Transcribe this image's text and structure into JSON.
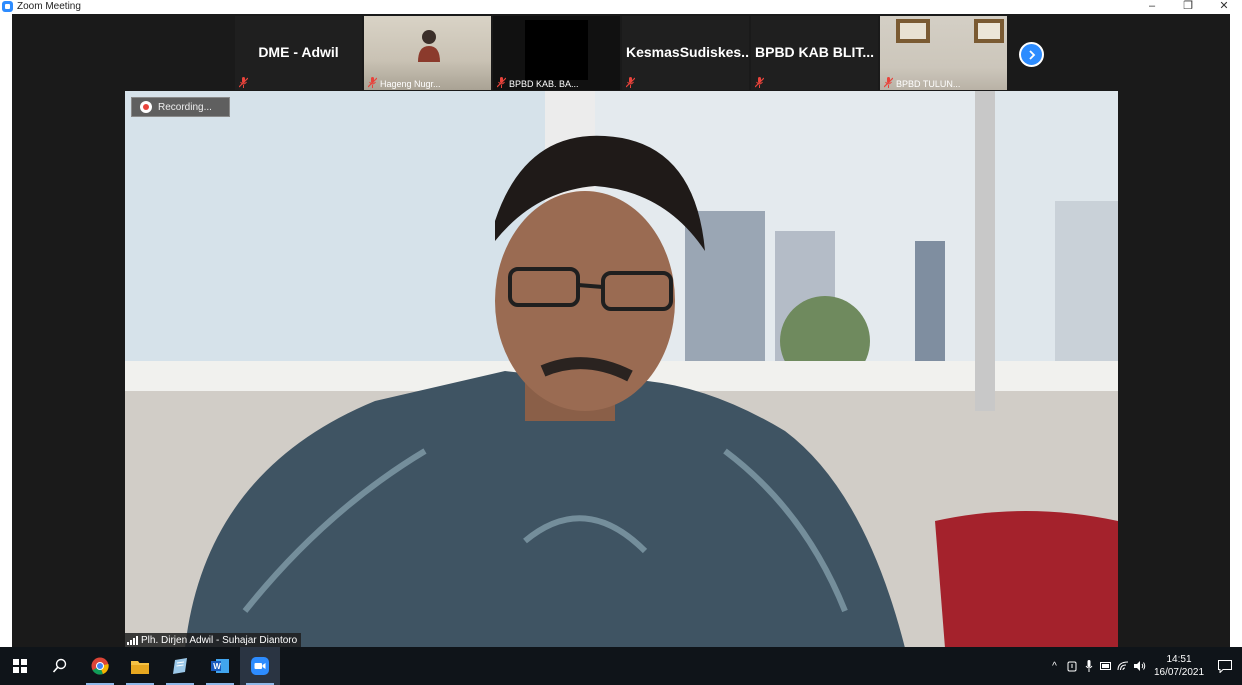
{
  "window": {
    "title": "Zoom Meeting",
    "minimize": "–",
    "restore": "❐",
    "close": "✕"
  },
  "thumbnails": [
    {
      "name": "DME - Adwil",
      "label": ""
    },
    {
      "name": "",
      "label": "Hageng Nugr..."
    },
    {
      "name": "",
      "label": "BPBD KAB. BA..."
    },
    {
      "name": "KesmasSudiskes...",
      "label": ""
    },
    {
      "name": "BPBD KAB BLIT...",
      "label": ""
    },
    {
      "name": "",
      "label": "BPBD TULUN..."
    }
  ],
  "recording": {
    "label": "Recording..."
  },
  "speaker": {
    "name": "Plh. Dirjen Adwil - Suhajar Diantoro"
  },
  "taskbar": {
    "apps": [
      "windows-start",
      "search",
      "chrome",
      "file-explorer",
      "notes",
      "word",
      "zoom"
    ],
    "clock_time": "14:51",
    "clock_date": "16/07/2021"
  },
  "colors": {
    "accent": "#2d8cff",
    "muted_red": "#e8433b",
    "taskbar": "#0f1419"
  }
}
